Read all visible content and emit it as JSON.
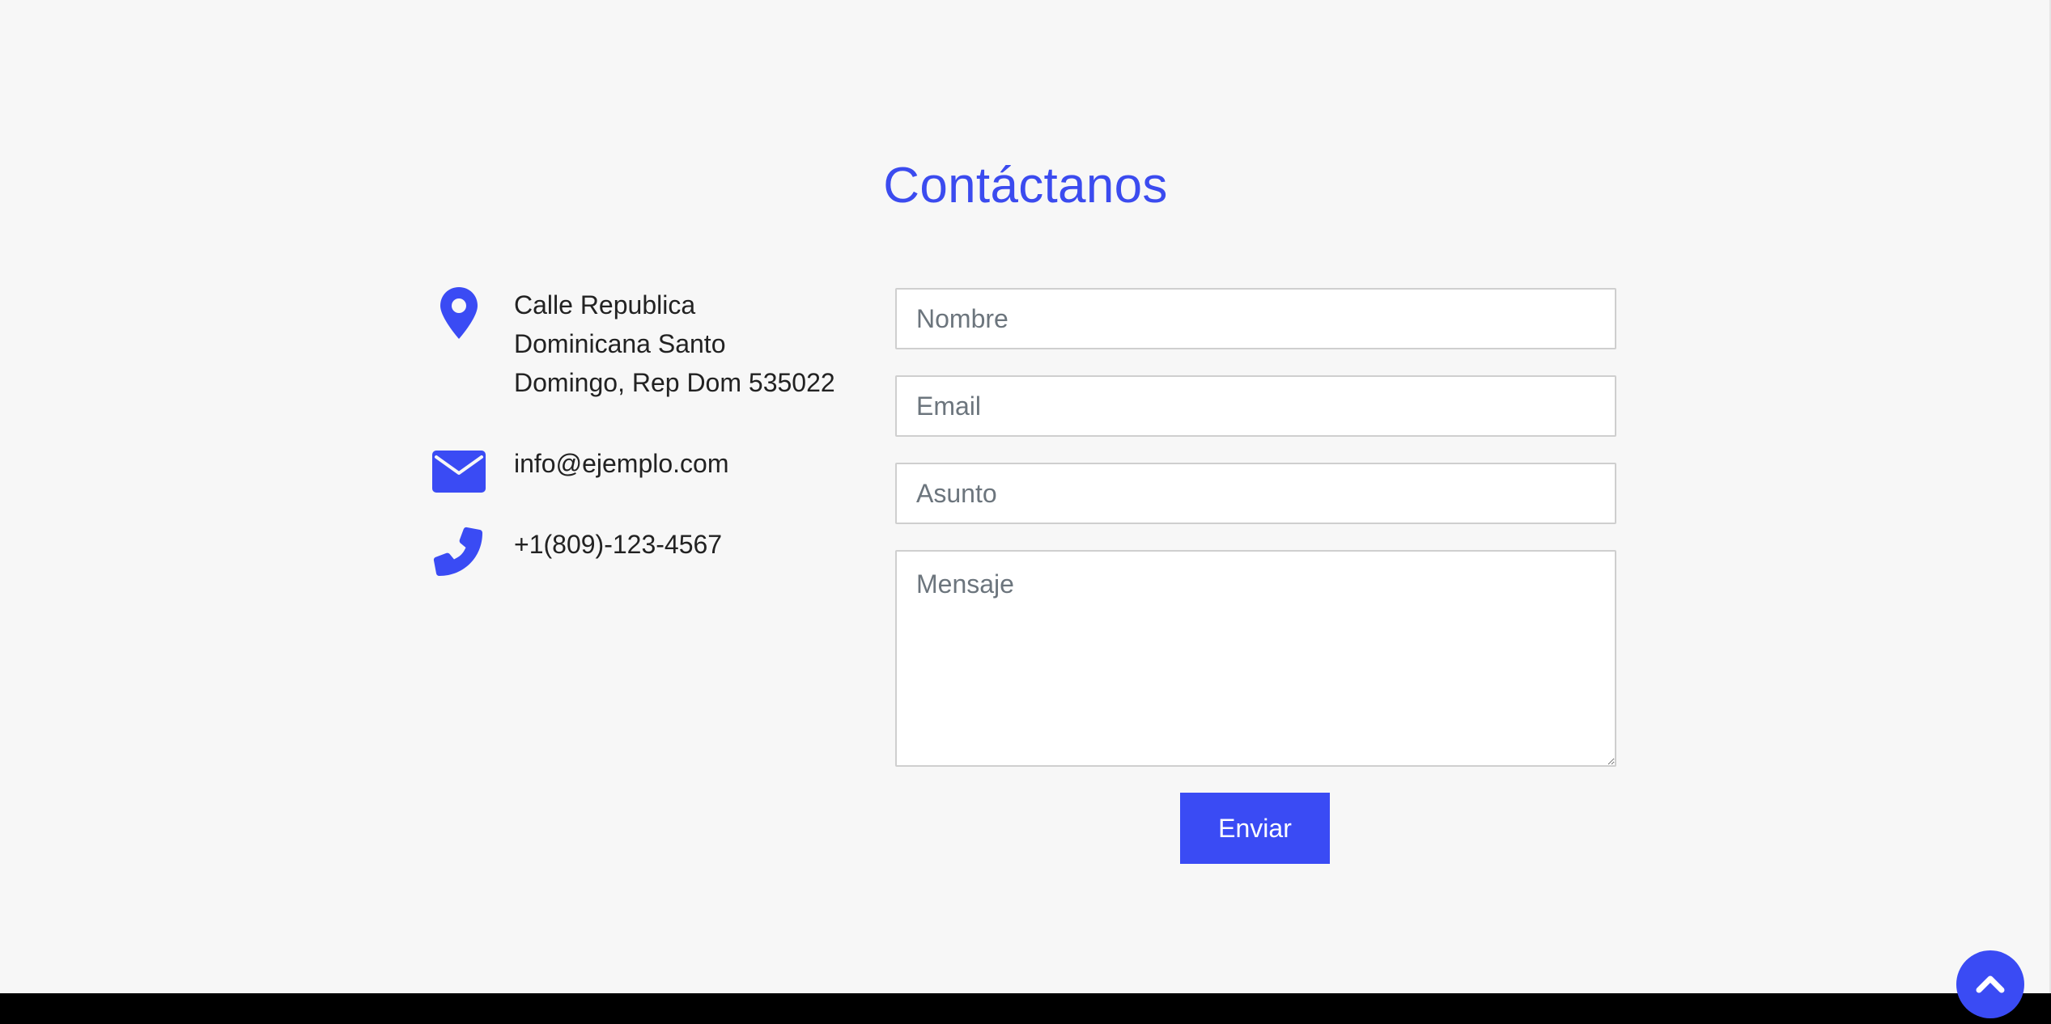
{
  "contact": {
    "title": "Contáctanos",
    "address": "Calle Republica\nDominicana Santo\nDomingo, Rep Dom 535022",
    "email": "info@ejemplo.com",
    "phone": "+1(809)-123-4567",
    "icons": {
      "address": "map-marker-icon",
      "email": "envelope-icon",
      "phone": "phone-icon"
    }
  },
  "form": {
    "name_placeholder": "Nombre",
    "email_placeholder": "Email",
    "subject_placeholder": "Asunto",
    "message_placeholder": "Mensaje",
    "submit_label": "Enviar"
  },
  "back_to_top": {
    "icon": "chevron-up-icon"
  },
  "colors": {
    "accent": "#3a4bf4",
    "background": "#f7f7f7",
    "footer": "#000000"
  }
}
